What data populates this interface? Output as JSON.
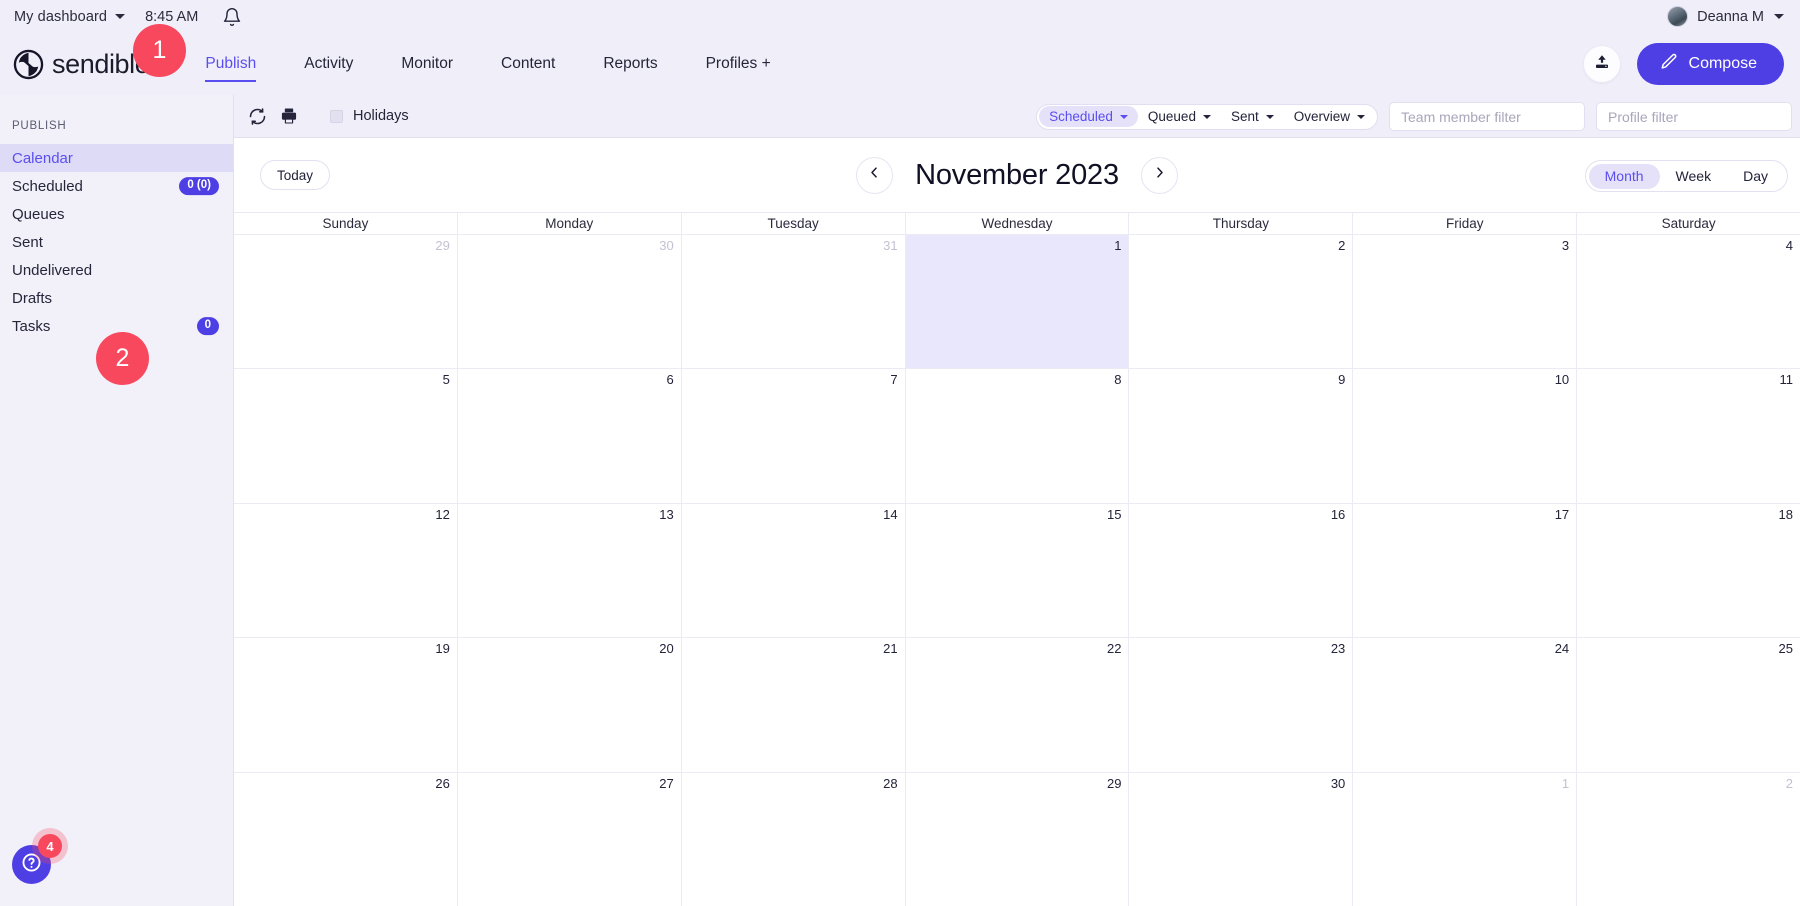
{
  "utility_bar": {
    "dashboard_label": "My dashboard",
    "time": "8:45 AM",
    "bell_icon": "bell-icon",
    "user_name": "Deanna M"
  },
  "brand": {
    "name": "sendible",
    "logo_icon": "sendible-logo-icon"
  },
  "nav": {
    "items": [
      {
        "label": "Publish",
        "active": true
      },
      {
        "label": "Activity",
        "active": false
      },
      {
        "label": "Monitor",
        "active": false
      },
      {
        "label": "Content",
        "active": false
      },
      {
        "label": "Reports",
        "active": false
      },
      {
        "label": "Profiles +",
        "active": false
      }
    ],
    "upload_icon": "upload-icon",
    "compose_label": "Compose",
    "compose_icon": "pencil-icon"
  },
  "sidebar": {
    "section_label": "PUBLISH",
    "items": [
      {
        "label": "Calendar",
        "badge": null,
        "active": true
      },
      {
        "label": "Scheduled",
        "badge": "0 (0)",
        "active": false
      },
      {
        "label": "Queues",
        "badge": null,
        "active": false
      },
      {
        "label": "Sent",
        "badge": null,
        "active": false
      },
      {
        "label": "Undelivered",
        "badge": null,
        "active": false
      },
      {
        "label": "Drafts",
        "badge": null,
        "active": false
      },
      {
        "label": "Tasks",
        "badge": "0",
        "active": false
      }
    ],
    "help_icon": "question-mark-icon",
    "help_badge": "4"
  },
  "toolbar": {
    "refresh_icon": "refresh-icon",
    "print_icon": "printer-icon",
    "holidays_label": "Holidays",
    "holidays_checked": false,
    "segments": [
      {
        "label": "Scheduled",
        "active": true
      },
      {
        "label": "Queued",
        "active": false
      },
      {
        "label": "Sent",
        "active": false
      },
      {
        "label": "Overview",
        "active": false
      }
    ],
    "team_filter_placeholder": "Team member filter",
    "team_filter_value": "",
    "profile_filter_placeholder": "Profile filter",
    "profile_filter_value": ""
  },
  "calendar": {
    "today_label": "Today",
    "prev_icon": "chevron-left-icon",
    "next_icon": "chevron-right-icon",
    "title": "November 2023",
    "views": [
      {
        "label": "Month",
        "active": true
      },
      {
        "label": "Week",
        "active": false
      },
      {
        "label": "Day",
        "active": false
      }
    ],
    "day_headers": [
      "Sunday",
      "Monday",
      "Tuesday",
      "Wednesday",
      "Thursday",
      "Friday",
      "Saturday"
    ],
    "weeks": [
      [
        {
          "num": "29",
          "other": true,
          "highlight": false
        },
        {
          "num": "30",
          "other": true,
          "highlight": false
        },
        {
          "num": "31",
          "other": true,
          "highlight": false
        },
        {
          "num": "1",
          "other": false,
          "highlight": true
        },
        {
          "num": "2",
          "other": false,
          "highlight": false
        },
        {
          "num": "3",
          "other": false,
          "highlight": false
        },
        {
          "num": "4",
          "other": false,
          "highlight": false
        }
      ],
      [
        {
          "num": "5",
          "other": false,
          "highlight": false
        },
        {
          "num": "6",
          "other": false,
          "highlight": false
        },
        {
          "num": "7",
          "other": false,
          "highlight": false
        },
        {
          "num": "8",
          "other": false,
          "highlight": false
        },
        {
          "num": "9",
          "other": false,
          "highlight": false
        },
        {
          "num": "10",
          "other": false,
          "highlight": false
        },
        {
          "num": "11",
          "other": false,
          "highlight": false
        }
      ],
      [
        {
          "num": "12",
          "other": false,
          "highlight": false
        },
        {
          "num": "13",
          "other": false,
          "highlight": false
        },
        {
          "num": "14",
          "other": false,
          "highlight": false
        },
        {
          "num": "15",
          "other": false,
          "highlight": false
        },
        {
          "num": "16",
          "other": false,
          "highlight": false
        },
        {
          "num": "17",
          "other": false,
          "highlight": false
        },
        {
          "num": "18",
          "other": false,
          "highlight": false
        }
      ],
      [
        {
          "num": "19",
          "other": false,
          "highlight": false
        },
        {
          "num": "20",
          "other": false,
          "highlight": false
        },
        {
          "num": "21",
          "other": false,
          "highlight": false
        },
        {
          "num": "22",
          "other": false,
          "highlight": false
        },
        {
          "num": "23",
          "other": false,
          "highlight": false
        },
        {
          "num": "24",
          "other": false,
          "highlight": false
        },
        {
          "num": "25",
          "other": false,
          "highlight": false
        }
      ],
      [
        {
          "num": "26",
          "other": false,
          "highlight": false
        },
        {
          "num": "27",
          "other": false,
          "highlight": false
        },
        {
          "num": "28",
          "other": false,
          "highlight": false
        },
        {
          "num": "29",
          "other": false,
          "highlight": false
        },
        {
          "num": "30",
          "other": false,
          "highlight": false
        },
        {
          "num": "1",
          "other": true,
          "highlight": false
        },
        {
          "num": "2",
          "other": true,
          "highlight": false
        }
      ]
    ]
  },
  "annotations": [
    {
      "number": "1"
    },
    {
      "number": "2"
    }
  ],
  "colors": {
    "accent": "#5b4ef0",
    "accent_button": "#4e3fe4",
    "badge_red": "#f8485e",
    "chrome_bg": "#f0eff9",
    "sidebar_bg": "#f2f1fa",
    "highlight_day": "#e9e7fb",
    "active_item_bg": "#dedbf6"
  }
}
